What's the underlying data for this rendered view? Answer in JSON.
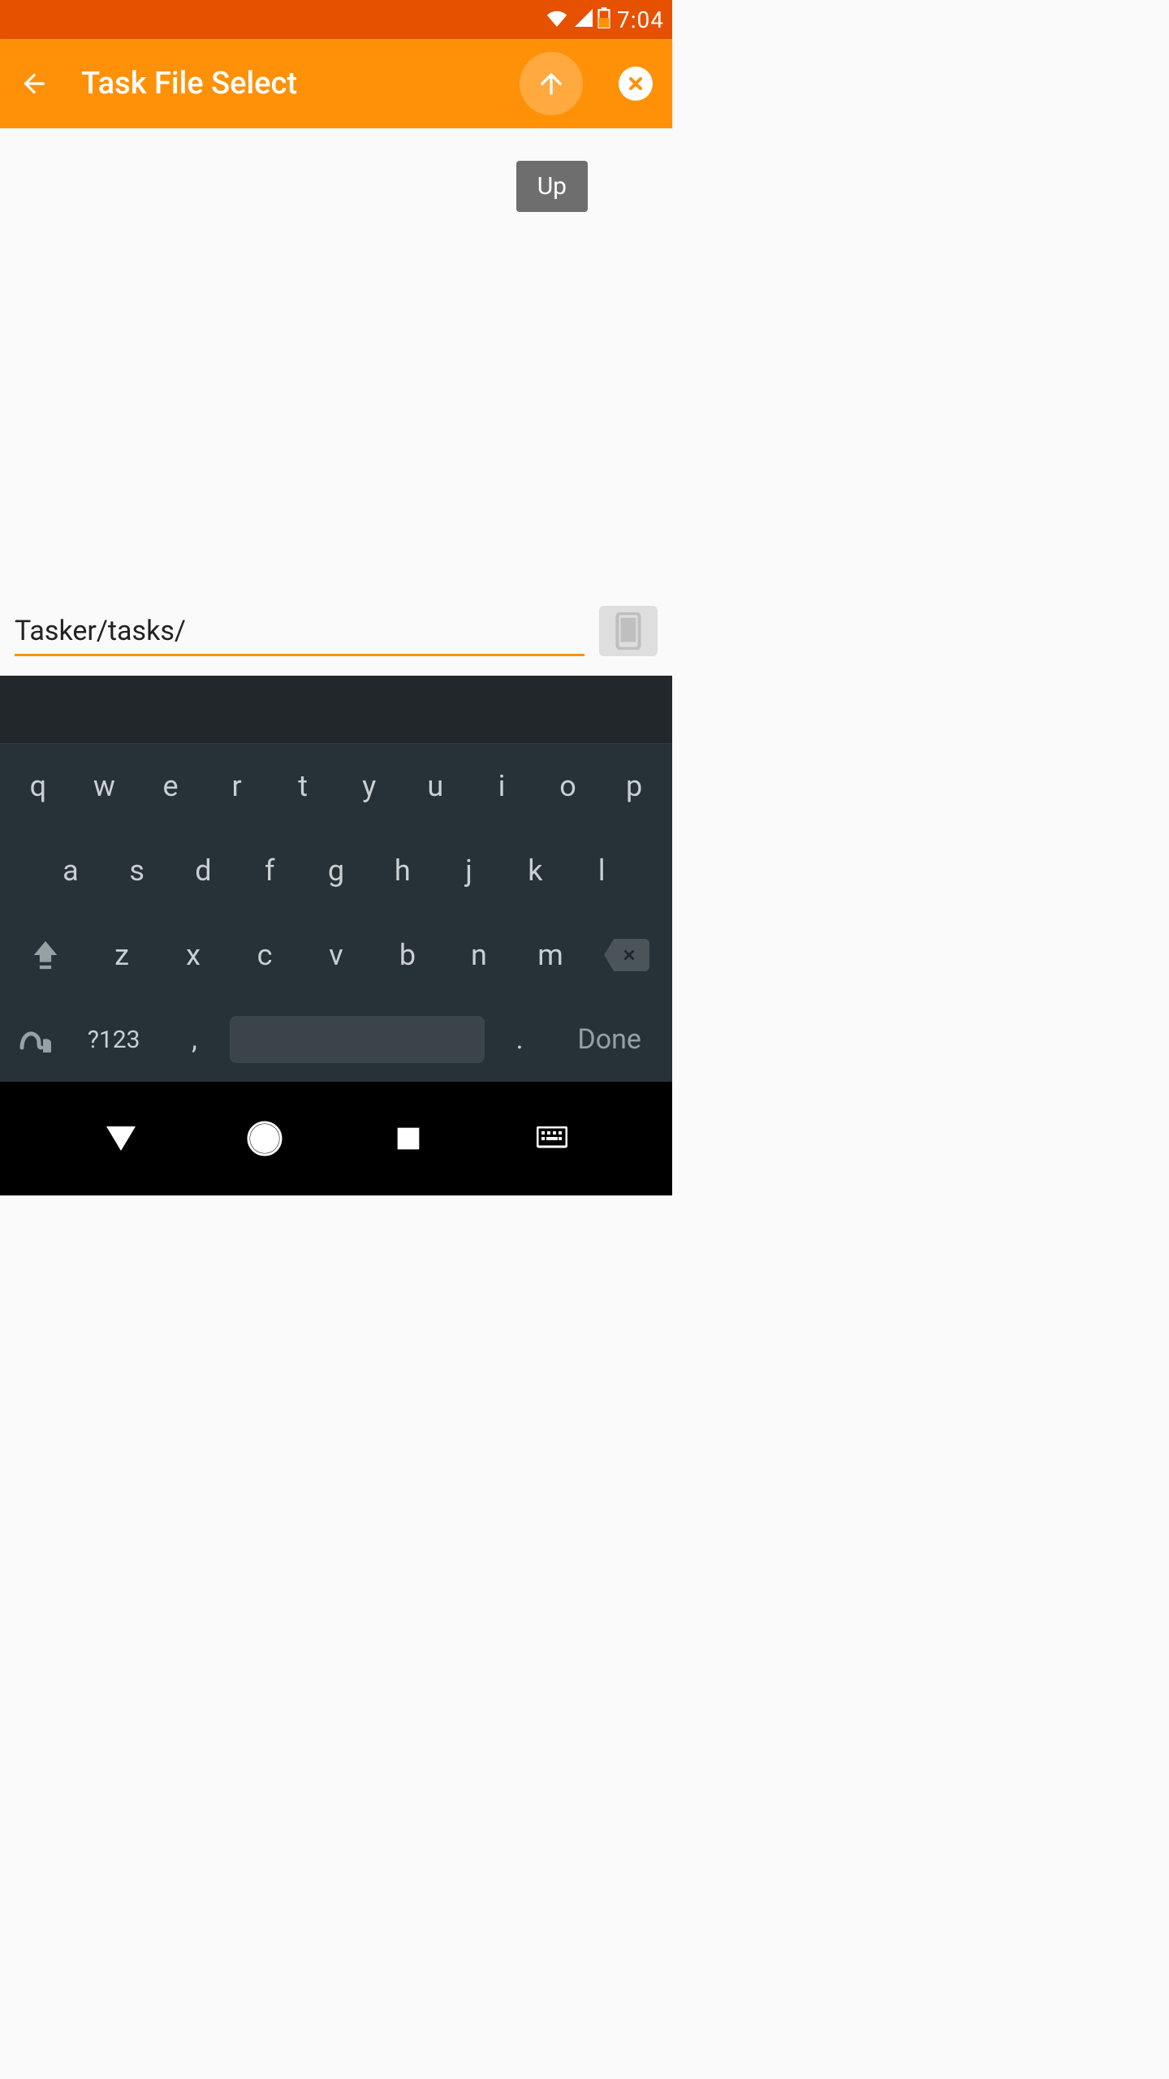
{
  "status_bar": {
    "time": "7:04"
  },
  "app_bar": {
    "title": "Task File Select"
  },
  "content": {
    "up_button_label": "Up",
    "path_value": "Tasker/tasks/"
  },
  "keyboard": {
    "row1": [
      "q",
      "w",
      "e",
      "r",
      "t",
      "y",
      "u",
      "i",
      "o",
      "p"
    ],
    "row2": [
      "a",
      "s",
      "d",
      "f",
      "g",
      "h",
      "j",
      "k",
      "l"
    ],
    "row3": [
      "z",
      "x",
      "c",
      "v",
      "b",
      "n",
      "m"
    ],
    "sym_label": "?123",
    "comma": ",",
    "dot": ".",
    "done_label": "Done"
  }
}
